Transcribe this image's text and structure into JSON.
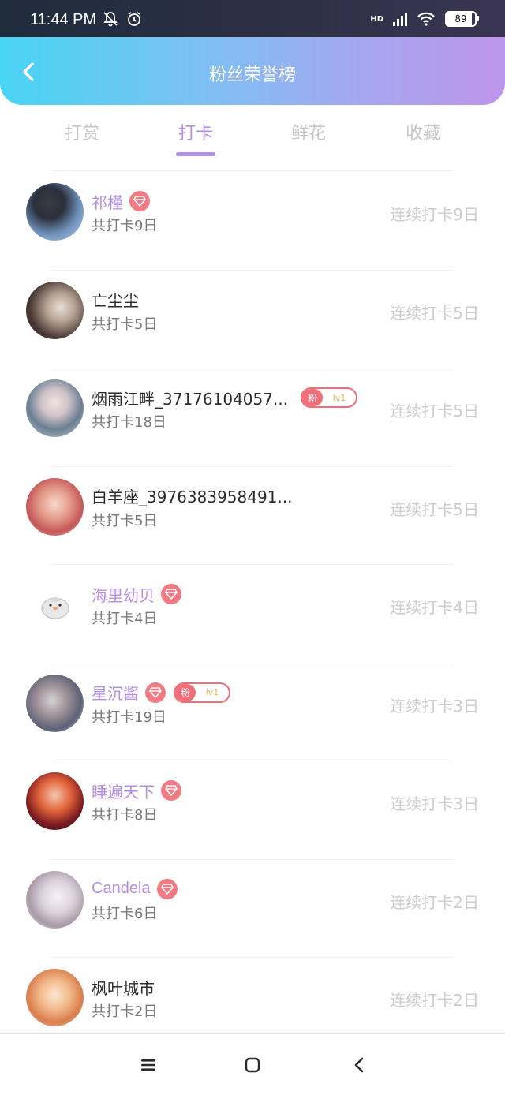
{
  "status_bar": {
    "time": "11:44 PM",
    "network": "HD",
    "battery": "89"
  },
  "header": {
    "title": "粉丝荣誉榜"
  },
  "tabs": [
    {
      "label": "打赏",
      "active": false
    },
    {
      "label": "打卡",
      "active": true
    },
    {
      "label": "鲜花",
      "active": false
    },
    {
      "label": "收藏",
      "active": false
    }
  ],
  "colors": {
    "accent": "#b58ee4",
    "badge_red": "#f27a82",
    "header_gradient_start": "#48d4f3",
    "header_gradient_end": "#bd95ea"
  },
  "rows": [
    {
      "name": "祁槿",
      "vip": true,
      "diamond": true,
      "fan_badge": false,
      "total": "共打卡9日",
      "streak": "连续打卡9日"
    },
    {
      "name": "亡尘尘",
      "vip": false,
      "diamond": false,
      "fan_badge": false,
      "total": "共打卡5日",
      "streak": "连续打卡5日"
    },
    {
      "name": "烟雨江畔_37176104057...",
      "vip": false,
      "diamond": false,
      "fan_badge": true,
      "fan_label": "粉",
      "fan_level": "lv1",
      "total": "共打卡18日",
      "streak": "连续打卡5日"
    },
    {
      "name": "白羊座_3976383958491...",
      "vip": false,
      "diamond": false,
      "fan_badge": false,
      "total": "共打卡5日",
      "streak": "连续打卡5日"
    },
    {
      "name": "海里幼贝",
      "vip": true,
      "diamond": true,
      "fan_badge": false,
      "total": "共打卡4日",
      "streak": "连续打卡4日"
    },
    {
      "name": "星沉酱",
      "vip": true,
      "diamond": true,
      "fan_badge": true,
      "fan_label": "粉",
      "fan_level": "lv1",
      "total": "共打卡19日",
      "streak": "连续打卡3日"
    },
    {
      "name": "睡遍天下",
      "vip": true,
      "diamond": true,
      "fan_badge": false,
      "total": "共打卡8日",
      "streak": "连续打卡3日"
    },
    {
      "name": "Candela",
      "vip": true,
      "diamond": true,
      "fan_badge": false,
      "total": "共打卡6日",
      "streak": "连续打卡2日"
    },
    {
      "name": "枫叶城市",
      "vip": false,
      "diamond": false,
      "fan_badge": false,
      "total": "共打卡2日",
      "streak": "连续打卡2日"
    }
  ]
}
